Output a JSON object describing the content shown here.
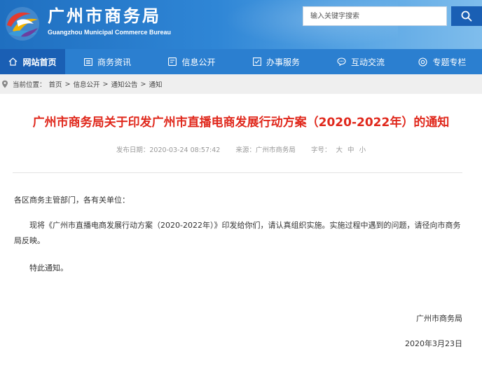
{
  "header": {
    "title": "广州市商务局",
    "subtitle": "Guangzhou Municipal Commerce Bureau",
    "search_placeholder": "输入关键字搜索"
  },
  "nav": {
    "items": [
      {
        "label": "网站首页",
        "icon": "home-icon",
        "active": true
      },
      {
        "label": "商务资讯",
        "icon": "newspaper-icon"
      },
      {
        "label": "信息公开",
        "icon": "document-icon"
      },
      {
        "label": "办事服务",
        "icon": "checklist-icon"
      },
      {
        "label": "互动交流",
        "icon": "chat-bubble-icon"
      },
      {
        "label": "专题专栏",
        "icon": "gear-icon"
      }
    ]
  },
  "breadcrumb": {
    "prefix": "当前位置：",
    "items": [
      "首页",
      "信息公开",
      "通知公告",
      "通知"
    ],
    "separator": ">"
  },
  "article": {
    "title": "广州市商务局关于印发广州市直播电商发展行动方案（2020-2022年）的通知",
    "publish_label": "发布日期：",
    "publish_date": "2020-03-24 08:57:42",
    "source_label": "来源：",
    "source": "广州市商务局",
    "font_label": "字号：",
    "font_sizes": [
      "大",
      "中",
      "小"
    ],
    "salutation": "各区商务主管部门，各有关单位：",
    "body": "现将《广州市直播电商发展行动方案（2020-2022年）》印发给你们，请认真组织实施。实施过程中遇到的问题，请径向市商务局反映。",
    "closing": "特此通知。",
    "signature": "广州市商务局",
    "date": "2020年3月23日"
  },
  "colors": {
    "header_blue": "#2f86d6",
    "nav_blue": "#2b7fd0",
    "nav_active": "#1a5fb4",
    "title_red": "#e0281c"
  }
}
